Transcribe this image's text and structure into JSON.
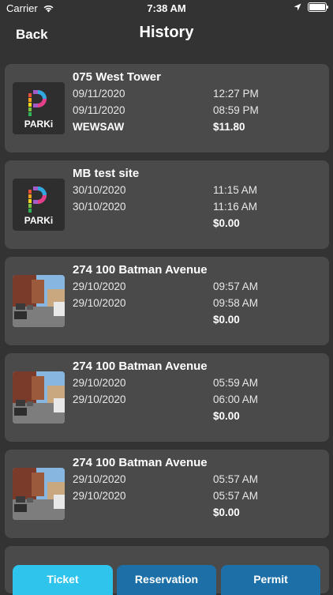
{
  "status_bar": {
    "carrier": "Carrier",
    "time": "7:38 AM"
  },
  "nav": {
    "back_label": "Back",
    "title": "History"
  },
  "logo_text": "PARKi",
  "items": [
    {
      "site": "075 West Tower",
      "date_in": "09/11/2020",
      "date_out": "09/11/2020",
      "time_in": "12:27 PM",
      "time_out": "08:59 PM",
      "plate": "WEWSAW",
      "amount": "$11.80",
      "thumbnail": "parki-logo"
    },
    {
      "site": "MB test site",
      "date_in": "30/10/2020",
      "date_out": "30/10/2020",
      "time_in": "11:15 AM",
      "time_out": "11:16 AM",
      "plate": "",
      "amount": "$0.00",
      "thumbnail": "parki-logo"
    },
    {
      "site": "274 100 Batman Avenue",
      "date_in": "29/10/2020",
      "date_out": "29/10/2020",
      "time_in": "09:57 AM",
      "time_out": "09:58 AM",
      "plate": "",
      "amount": "$0.00",
      "thumbnail": "street-photo"
    },
    {
      "site": "274 100 Batman Avenue",
      "date_in": "29/10/2020",
      "date_out": "29/10/2020",
      "time_in": "05:59 AM",
      "time_out": "06:00 AM",
      "plate": "",
      "amount": "$0.00",
      "thumbnail": "street-photo"
    },
    {
      "site": "274 100 Batman Avenue",
      "date_in": "29/10/2020",
      "date_out": "29/10/2020",
      "time_in": "05:57 AM",
      "time_out": "05:57 AM",
      "plate": "",
      "amount": "$0.00",
      "thumbnail": "street-photo"
    }
  ],
  "tabs": {
    "ticket": "Ticket",
    "reservation": "Reservation",
    "permit": "Permit"
  },
  "colors": {
    "background": "#333333",
    "card": "#4a4a4a",
    "tab_active": "#2fc4ec",
    "tab_inactive": "#1d6fa8"
  }
}
